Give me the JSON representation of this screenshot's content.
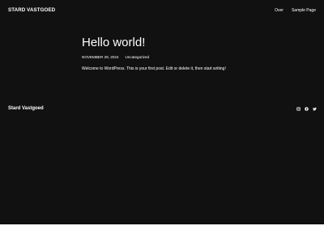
{
  "header": {
    "site_title": "STARD VASTGOED",
    "nav": [
      {
        "label": "Over"
      },
      {
        "label": "Sample Page"
      }
    ]
  },
  "post": {
    "title": "Hello world!",
    "date": "NOVEMBER 29, 2024",
    "category": "Uncategorized",
    "excerpt": "Welcome to WordPress. This is your first post. Edit or delete it, then start writing!"
  },
  "footer": {
    "site_title": "Stard Vastgoed",
    "social": [
      {
        "icon": "instagram-icon"
      },
      {
        "icon": "facebook-icon"
      },
      {
        "icon": "twitter-icon"
      }
    ]
  },
  "colors": {
    "background": "#111111",
    "text": "#ffffff"
  }
}
